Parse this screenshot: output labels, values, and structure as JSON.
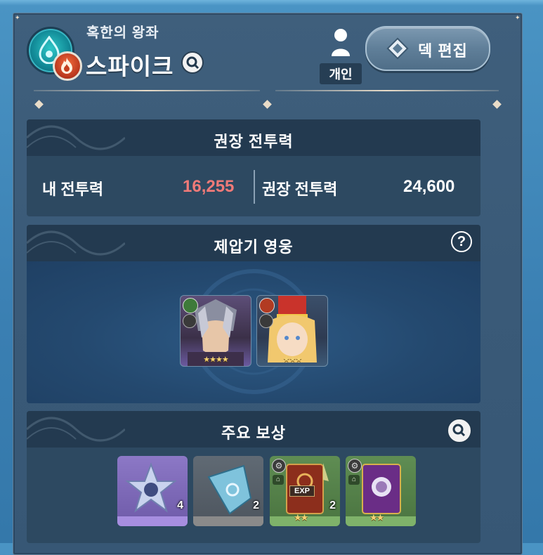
{
  "header": {
    "subtitle": "혹한의 왕좌",
    "boss_name": "스파이크",
    "personal_label": "개인",
    "edit_deck_label": "덱 편집"
  },
  "combat_power": {
    "title": "권장 전투력",
    "my_label": "내 전투력",
    "my_value": "16,255",
    "recommended_label": "권장 전투력",
    "recommended_value": "24,600",
    "my_value_color": "#f07a78"
  },
  "counter_heroes": {
    "title": "제압기 영웅",
    "help": "?",
    "heroes": [
      {
        "name": "hero-dark-knight",
        "stars": "★★★★",
        "element": "nature"
      },
      {
        "name": "hero-red-hat-girl",
        "stars": "★★★",
        "element": "fire"
      }
    ]
  },
  "rewards": {
    "title": "주요 보상",
    "items": [
      {
        "name": "star-crystal",
        "count": "4",
        "rarity_color": "#a78ee0"
      },
      {
        "name": "blue-shard",
        "count": "2",
        "rarity_color": "#8a8a8a"
      },
      {
        "name": "exp-book-red",
        "count": "2",
        "tag": "EXP",
        "stars": "★★",
        "rarity_color": "#7fb26a"
      },
      {
        "name": "purple-tarot-card",
        "stars": "★★",
        "rarity_color": "#7fb26a"
      }
    ]
  }
}
